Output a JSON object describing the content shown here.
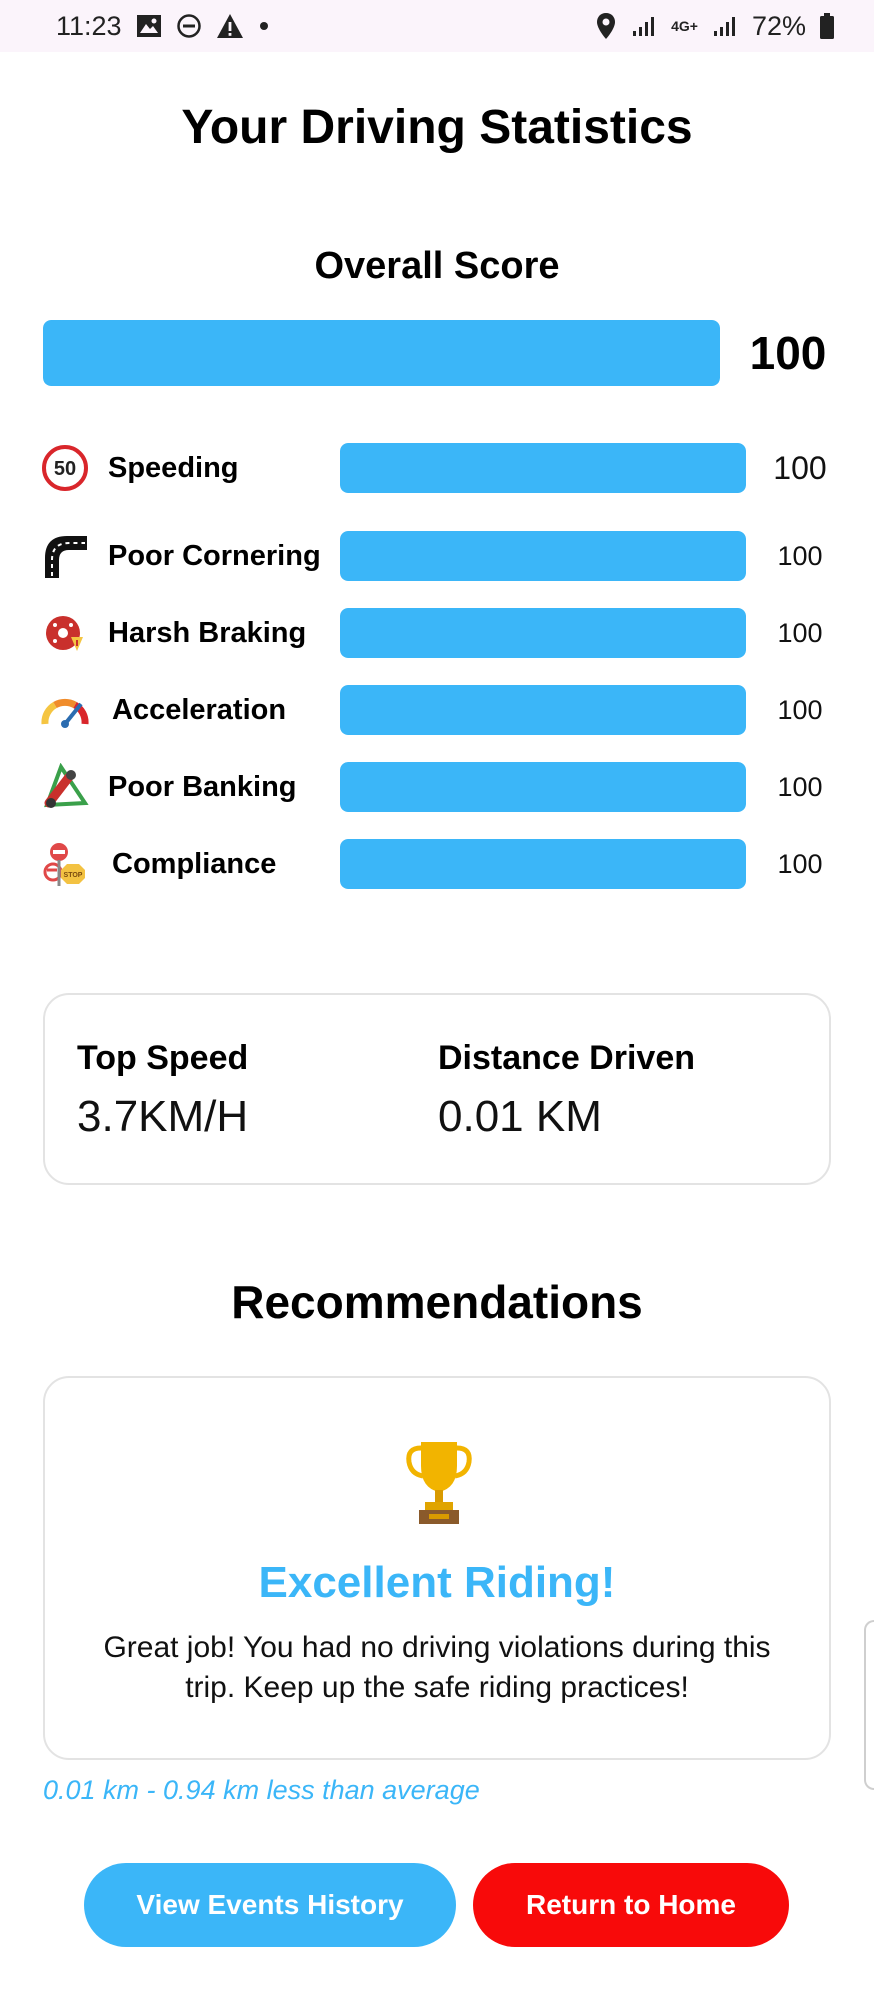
{
  "status_bar": {
    "time": "11:23",
    "network": "4G+",
    "battery": "72%",
    "icons_left": [
      "image-icon",
      "do-not-disturb-icon",
      "warning-icon",
      "dot-icon"
    ],
    "icons_right": [
      "location-icon",
      "signal-icon",
      "signal-icon",
      "battery-icon"
    ]
  },
  "header": {
    "title": "Your Driving Statistics"
  },
  "overall": {
    "heading": "Overall Score",
    "score": "100",
    "fill_percent": 100
  },
  "metrics": [
    {
      "label": "Speeding",
      "value": "100",
      "icon": "speed-limit-50-icon",
      "icon_text": "50",
      "fill_percent": 100
    },
    {
      "label": "Poor Cornering",
      "value": "100",
      "icon": "curved-road-icon",
      "fill_percent": 100
    },
    {
      "label": "Harsh Braking",
      "value": "100",
      "icon": "brake-disc-icon",
      "fill_percent": 100
    },
    {
      "label": "Acceleration",
      "value": "100",
      "icon": "speedometer-icon",
      "fill_percent": 100
    },
    {
      "label": "Poor Banking",
      "value": "100",
      "icon": "motorbike-lean-icon",
      "fill_percent": 100
    },
    {
      "label": "Compliance",
      "value": "100",
      "icon": "stop-sign-icon",
      "icon_text": "STOP",
      "fill_percent": 100
    }
  ],
  "stats": {
    "top_speed_label": "Top Speed",
    "top_speed_value": "3.7KM/H",
    "distance_label": "Distance Driven",
    "distance_value": "0.01 KM"
  },
  "recommendations": {
    "heading": "Recommendations",
    "icon": "trophy-icon",
    "title": "Excellent Riding!",
    "text": "Great job! You had no driving violations during this trip. Keep up the safe riding practices!"
  },
  "distance_note": "0.01 km - 0.94 km less than average",
  "buttons": {
    "history": "View Events History",
    "home": "Return to Home"
  },
  "colors": {
    "accent": "#3bb6f8",
    "danger": "#f80a0a",
    "bar_track": "#e6f3fb"
  }
}
